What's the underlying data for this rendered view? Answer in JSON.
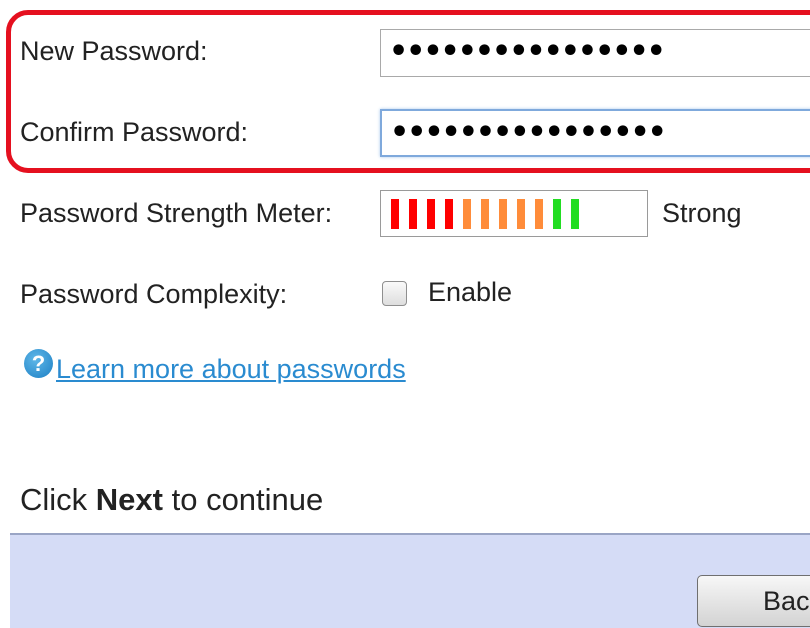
{
  "form": {
    "new_password": {
      "label": "New Password:",
      "value": "••••••••••••••••"
    },
    "confirm_password": {
      "label": "Confirm Password:",
      "value": "••••••••••••••••"
    },
    "strength_meter": {
      "label": "Password Strength Meter:",
      "strength_text": "Strong",
      "segments": [
        {
          "color": "#ff0000"
        },
        {
          "color": "#ff0000"
        },
        {
          "color": "#ff0000"
        },
        {
          "color": "#ff0000"
        },
        {
          "color": "#ff8c3a"
        },
        {
          "color": "#ff8c3a"
        },
        {
          "color": "#ff8c3a"
        },
        {
          "color": "#ff8c3a"
        },
        {
          "color": "#ff8c3a"
        },
        {
          "color": "#22dd22"
        },
        {
          "color": "#22dd22"
        }
      ]
    },
    "complexity": {
      "label": "Password Complexity:",
      "checkbox_label": "Enable",
      "checked": false
    },
    "help": {
      "icon": "help-icon",
      "link_text": "Learn more about passwords"
    }
  },
  "instruction": {
    "prefix": "Click ",
    "emphasis": "Next",
    "suffix": " to continue"
  },
  "footer": {
    "back_label": "Back"
  },
  "colors": {
    "highlight": "#e5101f",
    "link": "#2a8bd0",
    "footer_bg": "#d5dcf6"
  }
}
